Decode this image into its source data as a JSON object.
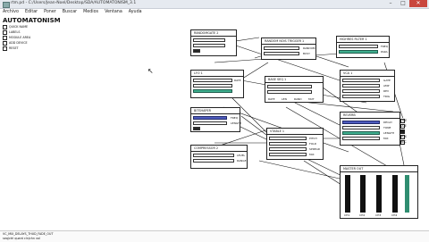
{
  "window": {
    "title": "rtm.pd - C:/Users/Jean-Noel/Desktop/SDA/AUTOMATONISM_3.1"
  },
  "menu": [
    "Archivo",
    "Editar",
    "Poner",
    "Buscar",
    "Medios",
    "Ventana",
    "Ayuda"
  ],
  "patch": {
    "title": "AUTOMATONISM"
  },
  "left_panel": {
    "items": [
      "QUICK NAME",
      "LABELS",
      "MODULE AREA",
      "ADD DEVICE",
      "RESET"
    ]
  },
  "nodes": {
    "randomgate": {
      "title": "RANDOMGATE 2"
    },
    "random_triggers": {
      "title": "RANDOM NOIS TRIGGER 1",
      "labels": [
        "RANDOM",
        "BUSY"
      ]
    },
    "highres_filter": {
      "title": "HIGHRES FILTER 1",
      "labels": [
        "FREQ",
        "PARA"
      ]
    },
    "lfo1": {
      "title": "LFO 1",
      "labels": [
        "RATE"
      ]
    },
    "sequencer": {
      "title": "BASE SEQ 1",
      "labels": [
        "RATE",
        "LEN",
        "RAND",
        "MUT"
      ]
    },
    "vca": {
      "title": "VCA 1",
      "labels": [
        "GATE",
        "AMP",
        "REV",
        "TRIG"
      ]
    },
    "bitshaper": {
      "title": "BITSHAPER",
      "labels": [
        "FREQ",
        "LENGTH"
      ]
    },
    "reverb": {
      "title": "REVERB",
      "labels": [
        "DECAY",
        "TONE",
        "LENGTH",
        "MIX",
        "RATE"
      ]
    },
    "compressor": {
      "title": "COMPRESSOR 2",
      "labels": [
        "LEVEL",
        "RANGE",
        "GO"
      ]
    },
    "envelope": {
      "title": "ENVELOPE 1",
      "labels": [
        "ATTACK",
        "DECAY",
        "CURVE"
      ]
    },
    "vtable": {
      "title": "VTABLE 1",
      "labels": [
        "PITCH",
        "FOLD",
        "SPREAD",
        "MIX"
      ]
    },
    "master": {
      "title": "MASTER OUT",
      "labels": [
        "CH1",
        "CH2",
        "CH3",
        "CH4"
      ]
    },
    "master_toggles": [
      "LIVE",
      "CUE",
      "EQ",
      "AUX",
      "REC"
    ]
  },
  "statusbar": {
    "line1": "VC_MIX_DELAYS_THUD_FADE_OUT",
    "line2": "seq/ctrl  quant  cln/chn  vol"
  },
  "colors": {
    "green": "#3fae8e",
    "blue": "#4e5cbe",
    "close": "#c9463d"
  }
}
